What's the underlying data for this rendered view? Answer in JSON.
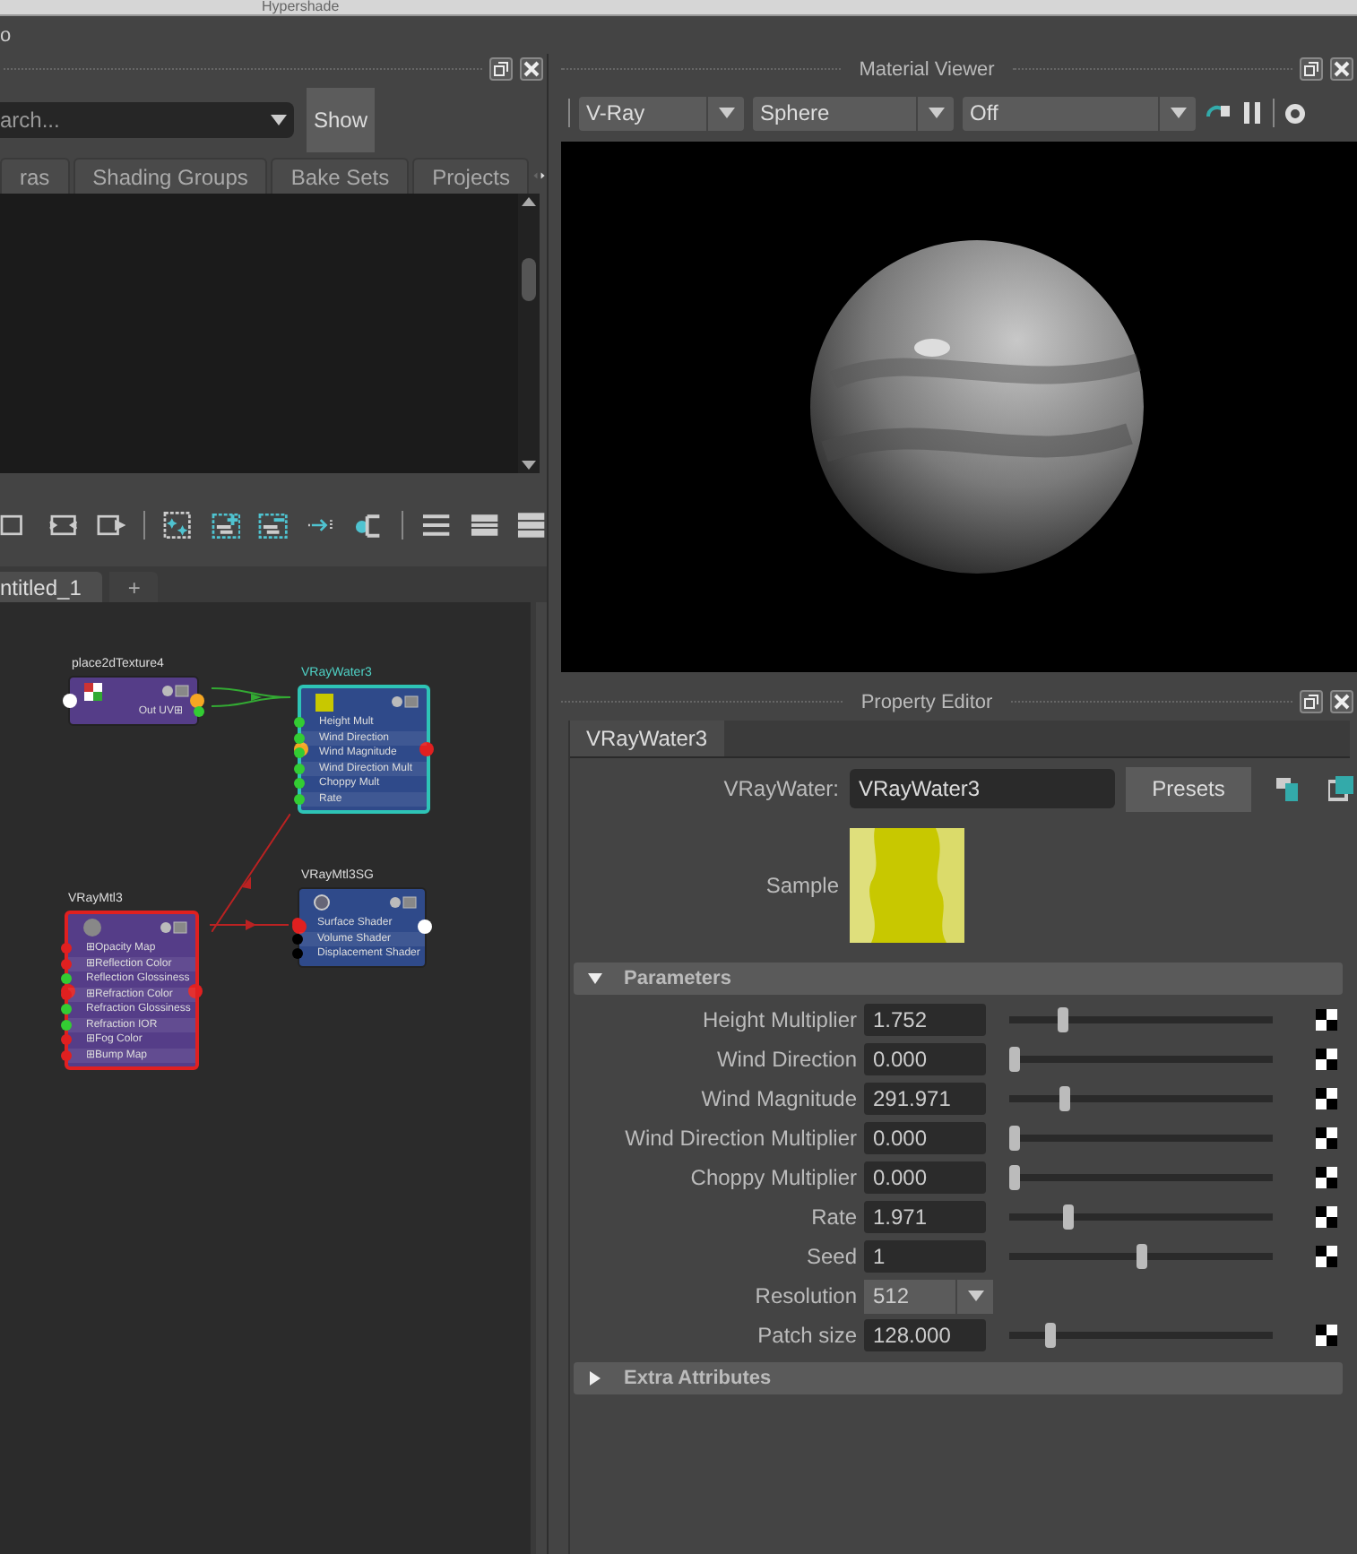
{
  "window": {
    "title": "Hypershade"
  },
  "menu_label": "o",
  "browser": {
    "search": {
      "placeholder": "arch..."
    },
    "show_button": "Show",
    "tabs": [
      {
        "label": "ras",
        "selected": false
      },
      {
        "label": "Shading Groups",
        "selected": false
      },
      {
        "label": "Bake Sets",
        "selected": false
      },
      {
        "label": "Projects",
        "selected": false
      }
    ]
  },
  "graph": {
    "tabs": [
      {
        "label": "ntitled_1",
        "selected": true
      },
      {
        "label": "+",
        "selected": false
      }
    ],
    "nodes": [
      {
        "name": "place2dTexture4",
        "kind": "texture",
        "selected": false,
        "rows": [
          "Out UV⊞"
        ]
      },
      {
        "name": "VRayWater3",
        "kind": "water",
        "selected": true,
        "rows": [
          "Height Mult",
          "Wind Direction",
          "Wind Magnitude",
          "Wind Direction Mult",
          "Choppy Mult",
          "Rate"
        ]
      },
      {
        "name": "VRayMtl3SG",
        "kind": "shading_group",
        "selected": false,
        "rows": [
          "Surface Shader",
          "Volume Shader",
          "Displacement Shader"
        ]
      },
      {
        "name": "VRayMtl3",
        "kind": "material",
        "selected": true,
        "rows": [
          "⊞Opacity Map",
          "⊞Reflection Color",
          "Reflection Glossiness",
          "⊞Refraction Color",
          "Refraction Glossiness",
          "Refraction IOR",
          "⊞Fog Color",
          "⊞Bump Map"
        ]
      }
    ]
  },
  "material_viewer": {
    "title": "Material Viewer",
    "dropdowns": [
      "V-Ray",
      "Sphere",
      "Off"
    ]
  },
  "property_editor": {
    "title": "Property Editor",
    "tabs": [
      {
        "label": "VRayWater3",
        "selected": true
      }
    ],
    "node_type_label": "VRayWater:",
    "node_name": "VRayWater3",
    "presets_button": "Presets",
    "sample_label": "Sample",
    "sections": [
      {
        "title": "Parameters",
        "expanded": true,
        "attributes": [
          {
            "kind": "slider",
            "label": "Height Multiplier",
            "value": "1.752",
            "level": 0.19
          },
          {
            "kind": "slider",
            "label": "Wind Direction",
            "value": "0.000",
            "level": 0
          },
          {
            "kind": "slider",
            "label": "Wind Magnitude",
            "value": "291.971",
            "level": 0.2
          },
          {
            "kind": "slider",
            "label": "Wind Direction Multiplier",
            "value": "0.000",
            "level": 0
          },
          {
            "kind": "slider",
            "label": "Choppy Multiplier",
            "value": "0.000",
            "level": 0
          },
          {
            "kind": "slider",
            "label": "Rate",
            "value": "1.971",
            "level": 0.21
          },
          {
            "kind": "slider",
            "label": "Seed",
            "value": "1",
            "level": 0.5
          },
          {
            "kind": "dropdown",
            "label": "Resolution",
            "value": "512"
          },
          {
            "kind": "slider",
            "label": "Patch size",
            "value": "128.000",
            "level": 0.14
          }
        ]
      },
      {
        "title": "Extra Attributes",
        "expanded": false
      }
    ]
  }
}
